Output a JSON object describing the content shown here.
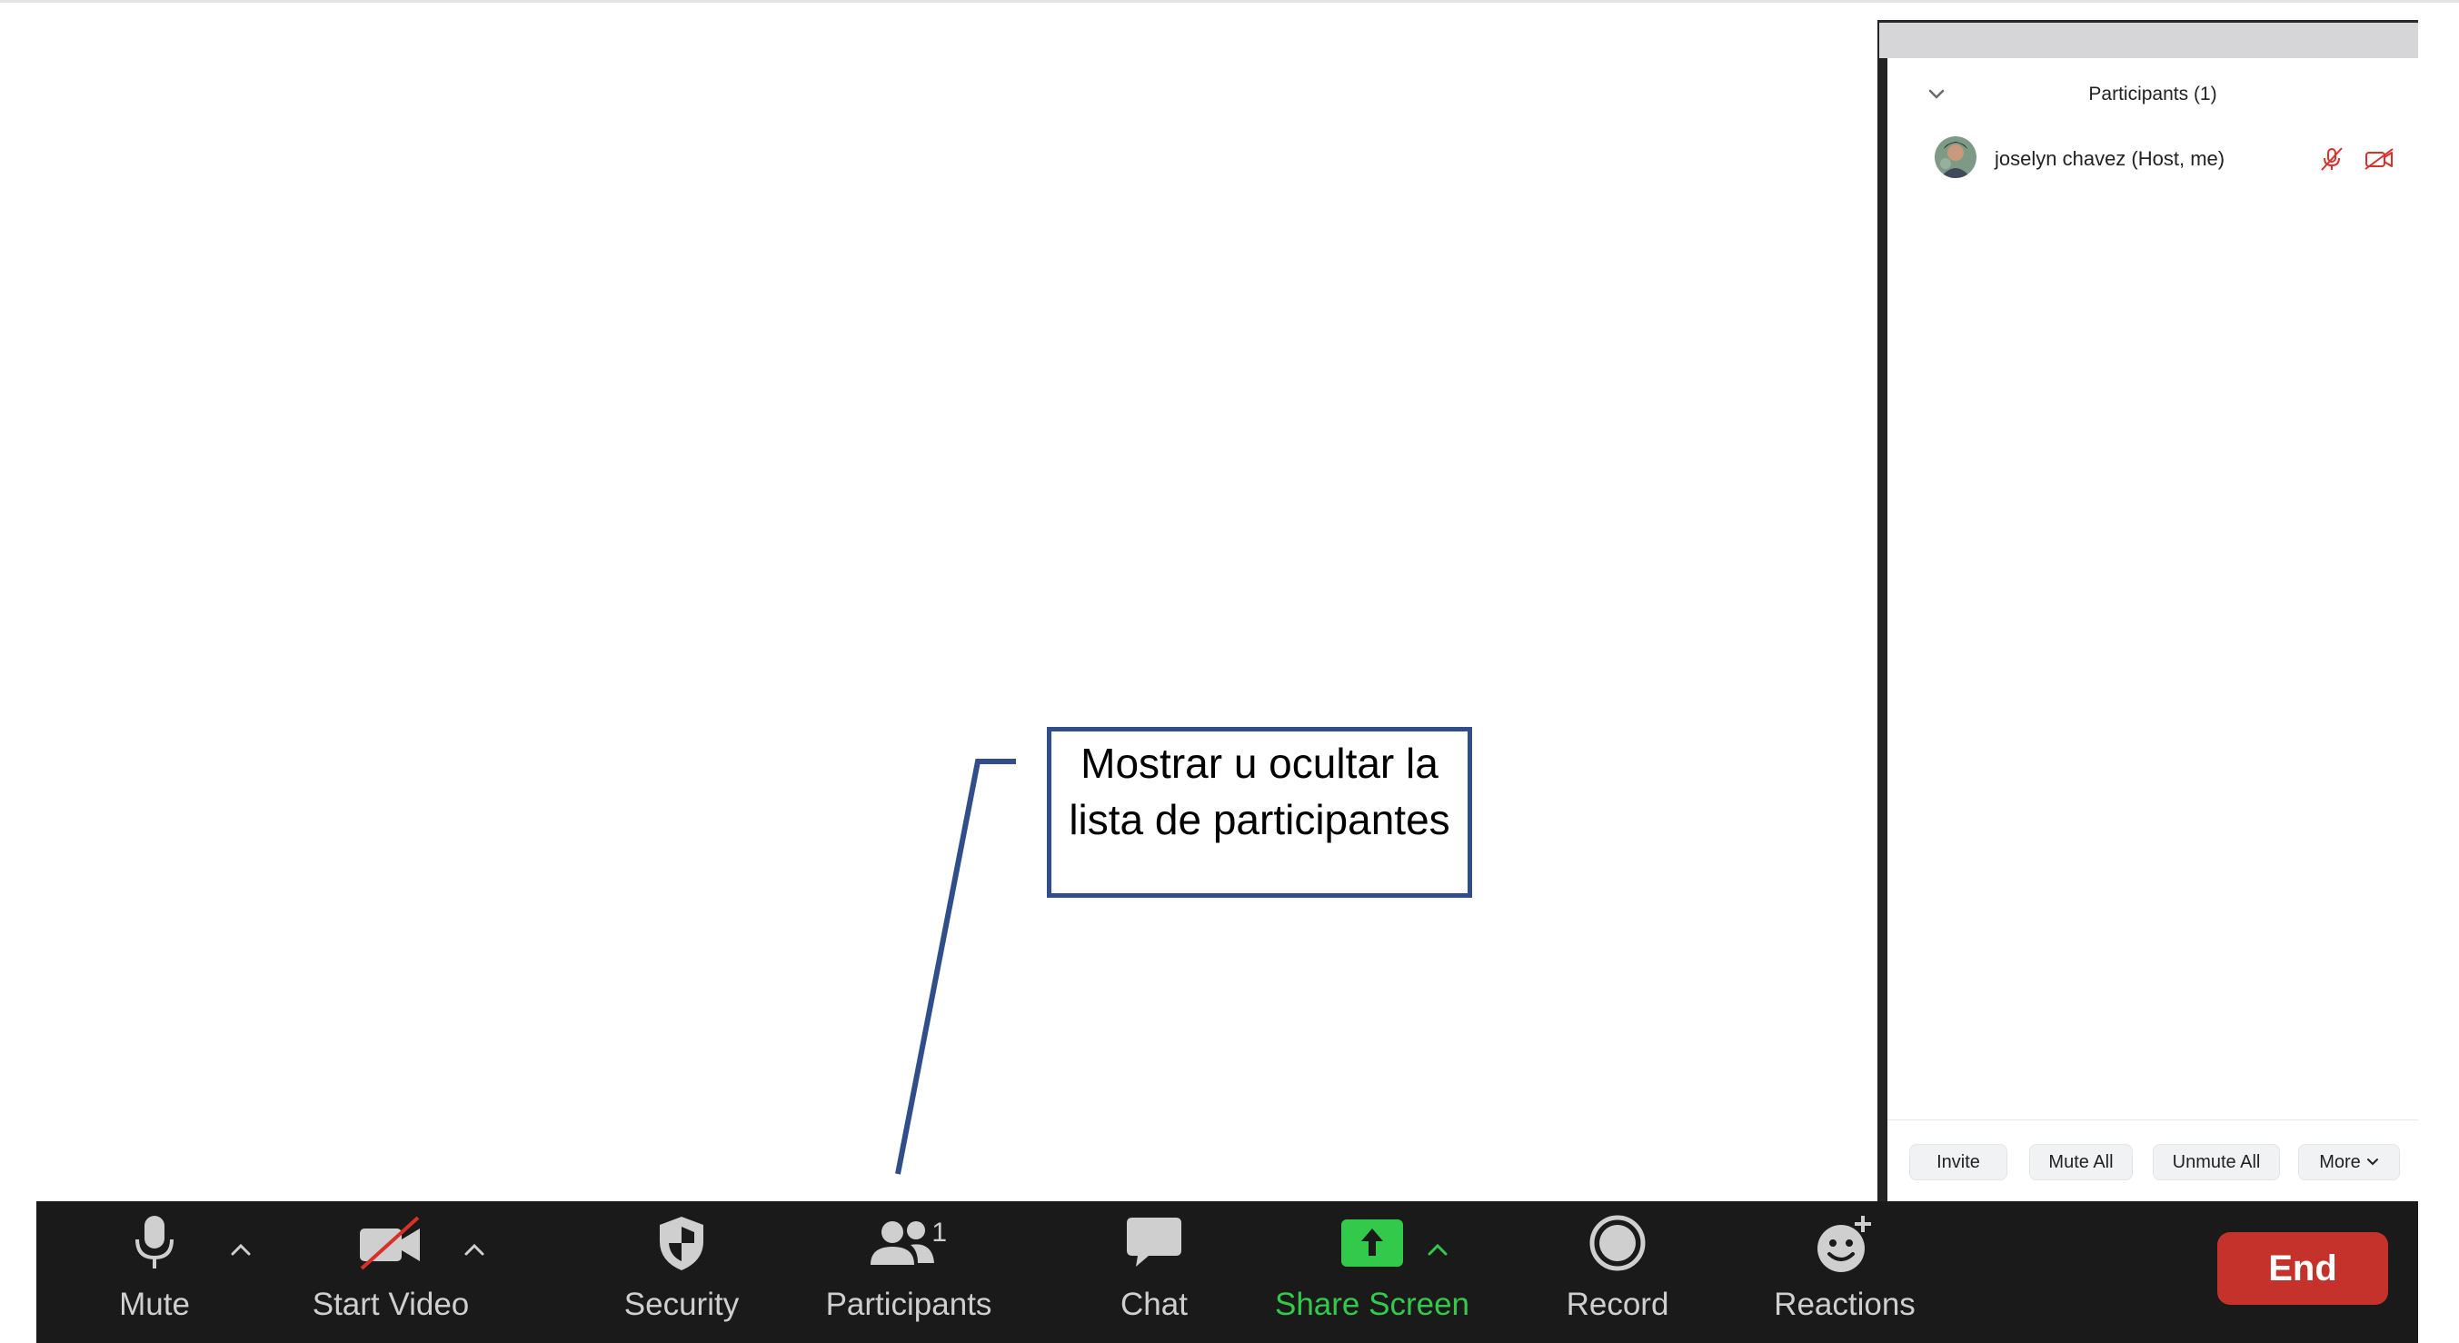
{
  "participants_panel": {
    "title": "Participants (1)",
    "participants": [
      {
        "name": "joselyn chavez (Host, me)",
        "mic": "mic-muted-icon",
        "video": "video-off-icon"
      }
    ],
    "buttons": {
      "invite": "Invite",
      "mute_all": "Mute All",
      "unmute_all": "Unmute All",
      "more": "More"
    }
  },
  "toolbar": {
    "mute": "Mute",
    "start_video": "Start Video",
    "security": "Security",
    "participants": "Participants",
    "participants_count": "1",
    "chat": "Chat",
    "share_screen": "Share Screen",
    "record": "Record",
    "reactions": "Reactions",
    "end": "End"
  },
  "callout": {
    "text": "Mostrar u ocultar la lista de participantes"
  },
  "colors": {
    "toolbar_bg": "#1a1a1a",
    "share_green": "#33c94b",
    "end_red": "#c5312b",
    "muted_red": "#d9302a",
    "callout_border": "#2f4e8a"
  }
}
